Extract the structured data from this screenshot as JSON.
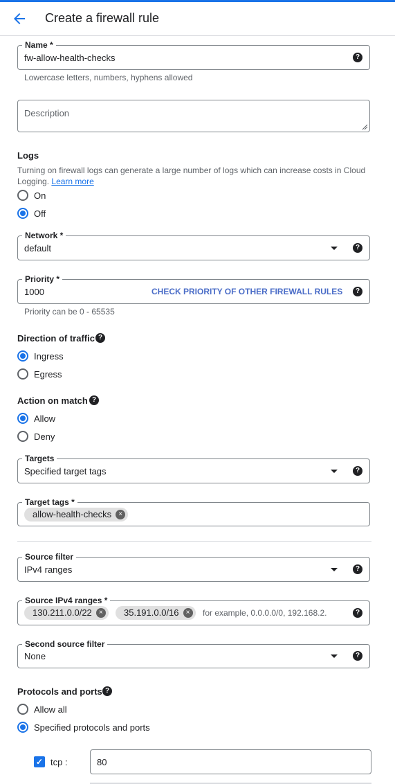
{
  "header": {
    "title": "Create a firewall rule",
    "back_icon": "arrow-left-icon"
  },
  "name": {
    "label": "Name *",
    "value": "fw-allow-health-checks",
    "hint": "Lowercase letters, numbers, hyphens allowed"
  },
  "description": {
    "placeholder": "Description"
  },
  "logs": {
    "title": "Logs",
    "text": "Turning on firewall logs can generate a large number of logs which can increase costs in Cloud Logging.",
    "learn_more": "Learn more",
    "options": [
      "On",
      "Off"
    ],
    "selected": "Off"
  },
  "network": {
    "label": "Network *",
    "value": "default"
  },
  "priority": {
    "label": "Priority *",
    "value": "1000",
    "action": "CHECK PRIORITY OF OTHER FIREWALL RULES",
    "hint": "Priority can be 0 - 65535"
  },
  "direction": {
    "title": "Direction of traffic",
    "options": [
      "Ingress",
      "Egress"
    ],
    "selected": "Ingress"
  },
  "action": {
    "title": "Action on match",
    "options": [
      "Allow",
      "Deny"
    ],
    "selected": "Allow"
  },
  "targets": {
    "label": "Targets",
    "value": "Specified target tags"
  },
  "target_tags": {
    "label": "Target tags *",
    "chips": [
      "allow-health-checks"
    ]
  },
  "source_filter": {
    "label": "Source filter",
    "value": "IPv4 ranges"
  },
  "source_ranges": {
    "label": "Source IPv4 ranges *",
    "chips": [
      "130.211.0.0/22",
      "35.191.0.0/16"
    ],
    "placeholder": "for example, 0.0.0.0/0, 192.168.2."
  },
  "second_source": {
    "label": "Second source filter",
    "value": "None"
  },
  "protocols": {
    "title": "Protocols and ports",
    "options": [
      "Allow all",
      "Specified protocols and ports"
    ],
    "selected": "Specified protocols and ports",
    "tcp_label": "tcp :",
    "tcp_value": "80"
  },
  "colors": {
    "accent": "#1a73e8",
    "border": "#80868b",
    "text": "#202124"
  }
}
